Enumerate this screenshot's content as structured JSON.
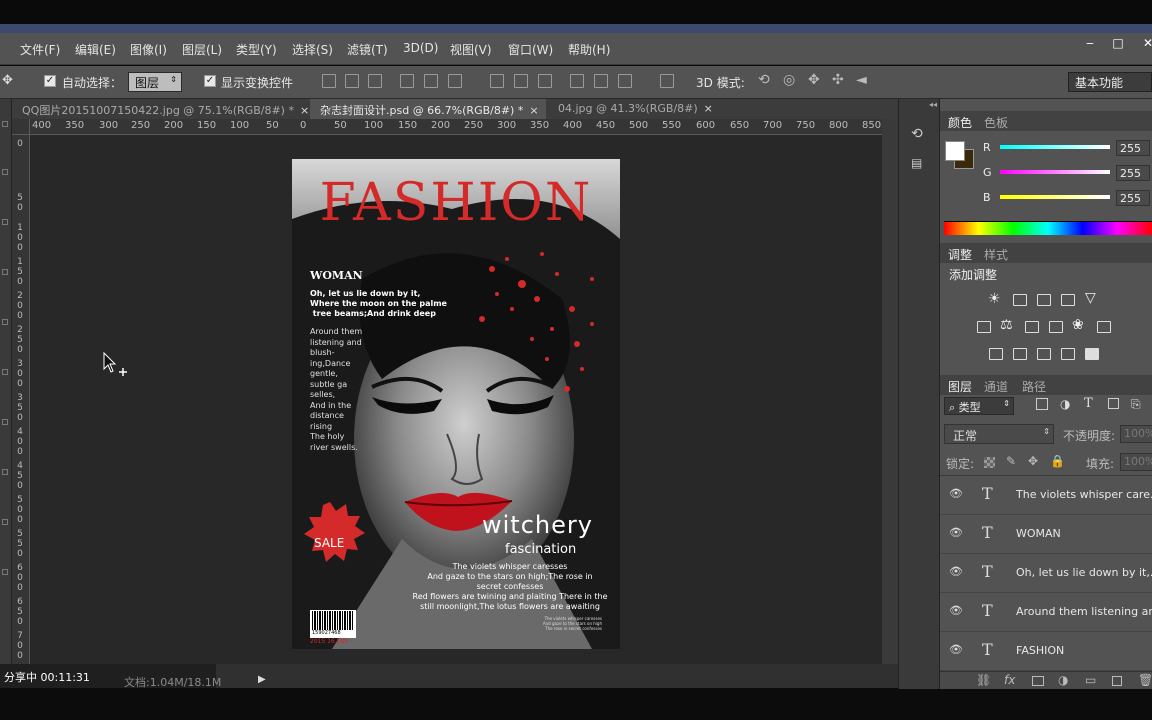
{
  "menu": {
    "items": [
      "文件(F)",
      "编辑(E)",
      "图像(I)",
      "图层(L)",
      "类型(Y)",
      "选择(S)",
      "滤镜(T)",
      "3D(D)",
      "视图(V)",
      "窗口(W)",
      "帮助(H)"
    ],
    "window_controls": [
      "‒",
      "□",
      "✕"
    ]
  },
  "options": {
    "auto_select_label": "自动选择：",
    "auto_select_value": "图层",
    "show_transform_label": "显示变换控件",
    "mode_3d_label": "3D 模式:",
    "workspace_value": "基本功能"
  },
  "tabs": [
    {
      "label": "QQ图片20151007150422.jpg @ 75.1%(RGB/8#) *",
      "close": "×"
    },
    {
      "label": "杂志封面设计.psd @ 66.7%(RGB/8#) *",
      "close": "×"
    },
    {
      "label": "04.jpg @ 41.3%(RGB/8#)",
      "close": "×"
    }
  ],
  "ruler_h": [
    "400",
    "350",
    "300",
    "250",
    "200",
    "150",
    "100",
    "50",
    "0",
    "50",
    "100",
    "150",
    "200",
    "250",
    "300",
    "350",
    "400",
    "450",
    "500",
    "550",
    "600",
    "650",
    "700",
    "750",
    "800",
    "850"
  ],
  "ruler_v": [
    "0",
    "5\n0",
    "1\n0\n0",
    "1\n5\n0",
    "2\n0\n0",
    "2\n5\n0",
    "3\n0\n0",
    "3\n5\n0",
    "4\n0\n0",
    "4\n5\n0",
    "5\n0\n0",
    "5\n5\n0",
    "6\n0\n0",
    "6\n5\n0",
    "7\n0\n0"
  ],
  "cover": {
    "title": "FASHION",
    "woman": "WOMAN",
    "intro": "Oh, let us lie down by it,\nWhere the moon on the palme\n tree beams;And drink deep",
    "column": "Around them\nlistening and\nblush-\ning,Dance\ngentle,\nsubtle ga\nselles,\nAnd in the\ndistance\nrising\nThe holy\nriver swells.",
    "sale": "SALE",
    "witchery": "witchery",
    "fascination": "fascination",
    "body": "The violets whisper caresses\nAnd gaze to the stars on high;The rose in\nsecret confesses\nRed flowers are twining and plaiting There in the\nstill moonlight,The lotus flowers are awaiting",
    "small": "The violets whisper caresses\nAnd gaze to the stars on high\nThe rose in secret confesses",
    "barcode_number": "159027468",
    "barcode_price": "2015 16 E88",
    "accent": "#d42a2a"
  },
  "status": {
    "sharing": "分享中 00:11:31",
    "doc": "文档:1.04M/18.1M"
  },
  "color_panel": {
    "tabs": [
      "颜色",
      "色板"
    ],
    "r_label": "R",
    "g_label": "G",
    "b_label": "B",
    "r": "255",
    "g": "255",
    "b": "255"
  },
  "adjust_panel": {
    "tabs": [
      "调整",
      "样式"
    ],
    "add_label": "添加调整"
  },
  "layers_panel": {
    "tabs": [
      "图层",
      "通道",
      "路径"
    ],
    "filter_kind": "类型",
    "blend_mode": "正常",
    "opacity_label": "不透明度:",
    "opacity_value": "100%",
    "lock_label": "锁定:",
    "fill_label": "填充:",
    "fill_value": "100%",
    "layers": [
      {
        "type_icon": "T",
        "name": "The violets whisper care..."
      },
      {
        "type_icon": "T",
        "name": "WOMAN"
      },
      {
        "type_icon": "T",
        "name": "Oh, let us lie down by it,..."
      },
      {
        "type_icon": "T",
        "name": "Around them listening an..."
      },
      {
        "type_icon": "T",
        "name": "FASHION"
      }
    ]
  }
}
